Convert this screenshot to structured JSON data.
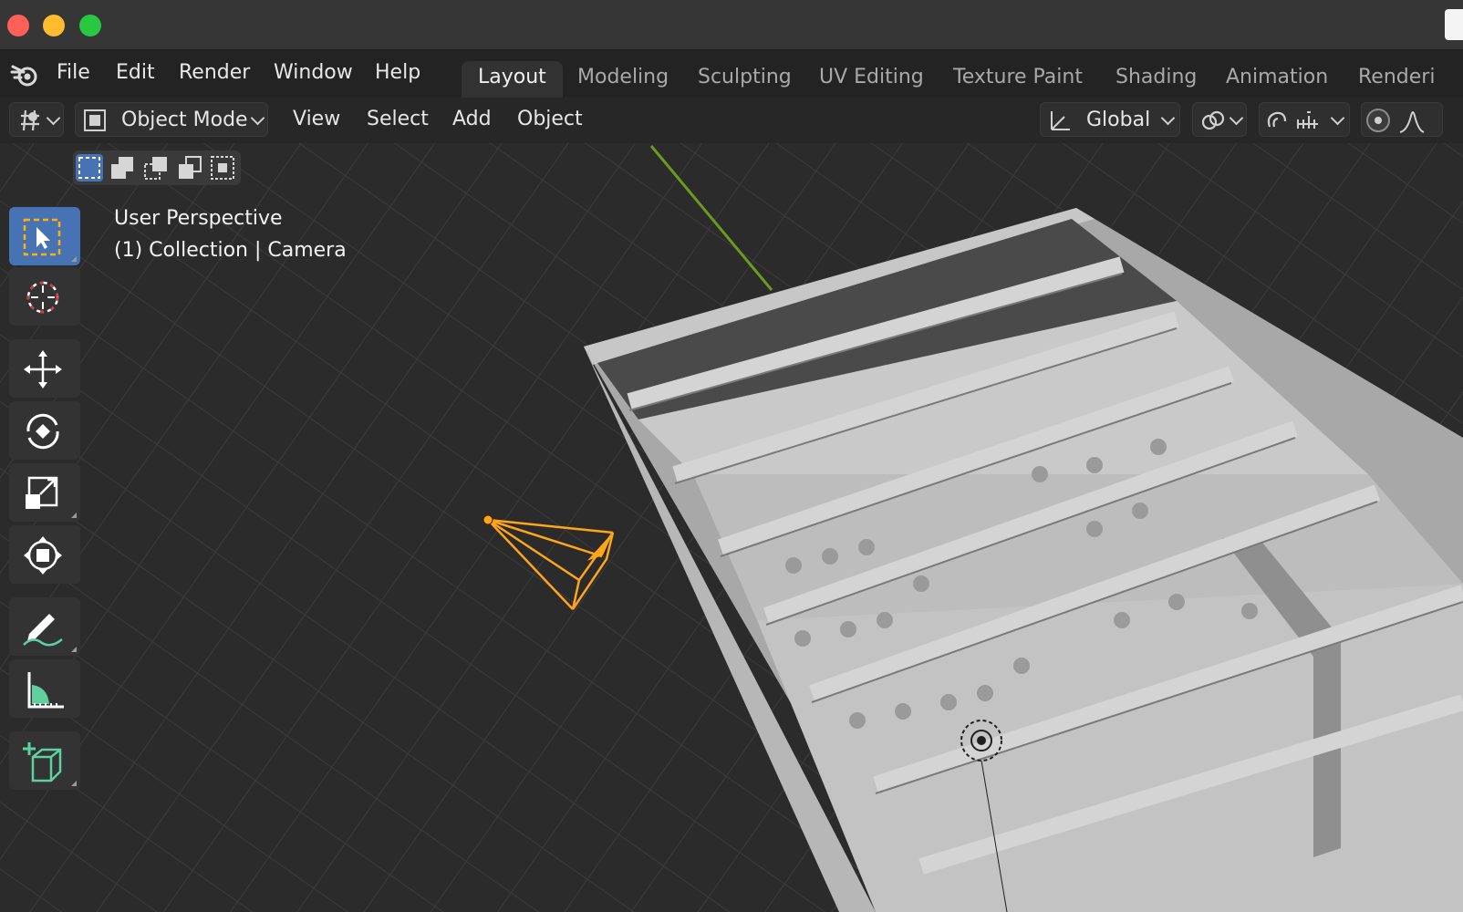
{
  "window": {
    "traffic_lights": [
      "close",
      "minimize",
      "maximize"
    ]
  },
  "menubar": {
    "items": [
      "File",
      "Edit",
      "Render",
      "Window",
      "Help"
    ]
  },
  "workspaces": {
    "tabs": [
      "Layout",
      "Modeling",
      "Sculpting",
      "UV Editing",
      "Texture Paint",
      "Shading",
      "Animation",
      "Renderi"
    ],
    "active": "Layout"
  },
  "header": {
    "mode_label": "Object Mode",
    "menus": [
      "View",
      "Select",
      "Add",
      "Object"
    ],
    "transform_orientation": "Global"
  },
  "viewport": {
    "perspective_label": "User Perspective",
    "context_label": "(1) Collection | Camera"
  },
  "toolbar": {
    "tools": [
      "select-box",
      "cursor",
      "move",
      "rotate",
      "scale",
      "transform",
      "annotate",
      "measure",
      "add-cube"
    ],
    "active_tool": "select-box"
  },
  "colors": {
    "accent": "#4772b3",
    "selection_orange": "#ffa519",
    "grid_bg": "#2b2b2b",
    "axis_green": "#6a9a1f"
  }
}
